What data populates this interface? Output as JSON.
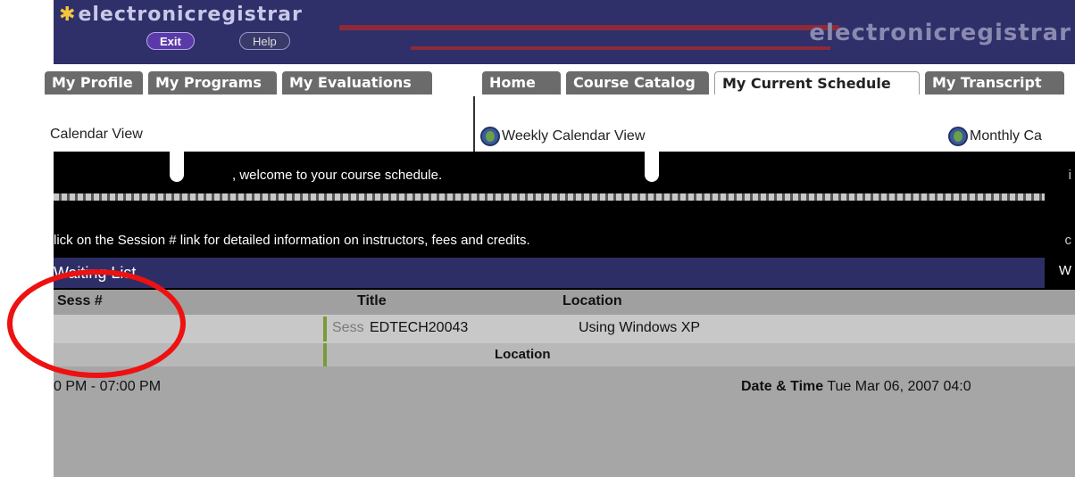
{
  "banner": {
    "logo_text": "electronicregistrar",
    "brand_right": "electronicregistrar",
    "exit_label": "Exit",
    "help_label": "Help"
  },
  "tabs": {
    "left": [
      "My Profile",
      "My Programs",
      "My Evaluations"
    ],
    "right": [
      "Home",
      "Course Catalog",
      "My Current Schedule",
      "My Transcript"
    ],
    "active": "My Current Schedule"
  },
  "views": {
    "list": "Calendar View",
    "weekly": "Weekly Calendar View",
    "monthly": "Monthly Ca"
  },
  "welcome": ", welcome to your course schedule.",
  "instruction": "lick on the Session # link for detailed information on instructors, fees and credits.",
  "waiting_list": {
    "header": "Waiting List",
    "columns": [
      "Sess #",
      "Title",
      "Location"
    ],
    "session_label": "Sess",
    "session_number": "EDTECH20043",
    "title": "Using Windows XP",
    "location_label": "Location",
    "time_range": "0 PM - 07:00 PM",
    "datetime_label": "Date & Time",
    "datetime_value": "Tue Mar 06, 2007 04:0"
  },
  "colors": {
    "banner": "#2f2f6a",
    "tab": "#6b6b6b",
    "header_band": "#2e2e66",
    "annotation": "#ee1111"
  }
}
